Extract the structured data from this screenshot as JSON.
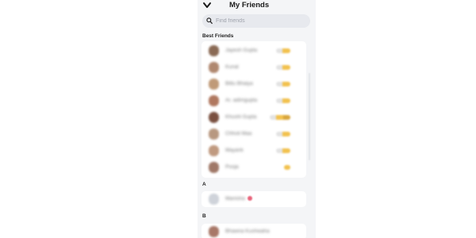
{
  "header": {
    "title": "My Friends",
    "back_icon": "chevron-down-icon"
  },
  "search": {
    "placeholder": "Find friends",
    "icon": "search-icon"
  },
  "sections": {
    "best_friends_label": "Best Friends",
    "a_label": "A",
    "b_label": "B"
  },
  "best_friends": [
    {
      "name": "Jayesh Gupta",
      "avatar_color": "#8a6a55"
    },
    {
      "name": "Kunal",
      "avatar_color": "#b08870"
    },
    {
      "name": "Bittu Bhaiya",
      "avatar_color": "#c09a78"
    },
    {
      "name": "Ar. adimgupta",
      "avatar_color": "#b07860"
    },
    {
      "name": "Khushi Gupta",
      "avatar_color": "#7a5040"
    },
    {
      "name": "Chhoti Maa",
      "avatar_color": "#b89880"
    },
    {
      "name": "Mayank",
      "avatar_color": "#c09a80"
    },
    {
      "name": "Pooja",
      "avatar_color": "#a07868"
    }
  ],
  "a_friends": [
    {
      "name": "Manisha",
      "avatar_color": "#cfd3da"
    }
  ],
  "b_friends": [
    {
      "name": "Bhawna Kushwaha",
      "avatar_color": "#a87868"
    }
  ],
  "colors": {
    "background": "#f4f5f7",
    "card": "#ffffff",
    "score_badge": "#f2c14e",
    "emoji_heart": "#e8637a"
  }
}
